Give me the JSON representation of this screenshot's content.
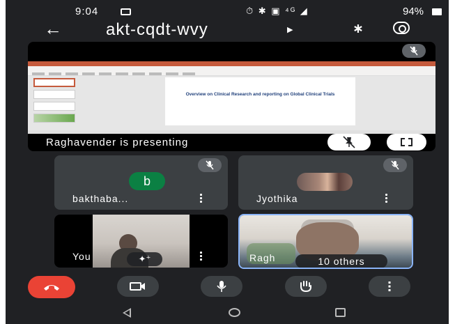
{
  "status_bar": {
    "time": "9:04",
    "status_icons": "⏱ ✱ ▣ ⁴ᴳ ◢",
    "battery": "94%"
  },
  "header": {
    "meeting_code": "akt-cqdt-wvy",
    "back_icon": "arrow-left-icon",
    "caret_icon": "caret-right-icon",
    "bluetooth_icon": "bluetooth-icon",
    "switch_camera_icon": "switch-camera-icon"
  },
  "presentation": {
    "slide_title": "Overview on Clinical Research and reporting on Global Clinical Trials",
    "presenting_text": "Raghavender is presenting",
    "muted": true
  },
  "participants": [
    {
      "name": "bakthaba...",
      "avatar_letter": "b",
      "avatar_color": "#0b8043",
      "muted": true
    },
    {
      "name": "Jyothika",
      "muted": true
    },
    {
      "name": "You",
      "effects_icon": "sparkle-icon"
    },
    {
      "name": "Ragh",
      "others_label": "10 others",
      "active_speaker": true
    }
  ],
  "controls": {
    "end_call_color": "#ea4335",
    "items": [
      "end-call-icon",
      "camera-icon",
      "mic-icon",
      "raise-hand-icon",
      "more-vertical-icon"
    ]
  },
  "colors": {
    "background": "#202124",
    "tile": "#3c4043",
    "active_border": "#8ab4f8"
  }
}
